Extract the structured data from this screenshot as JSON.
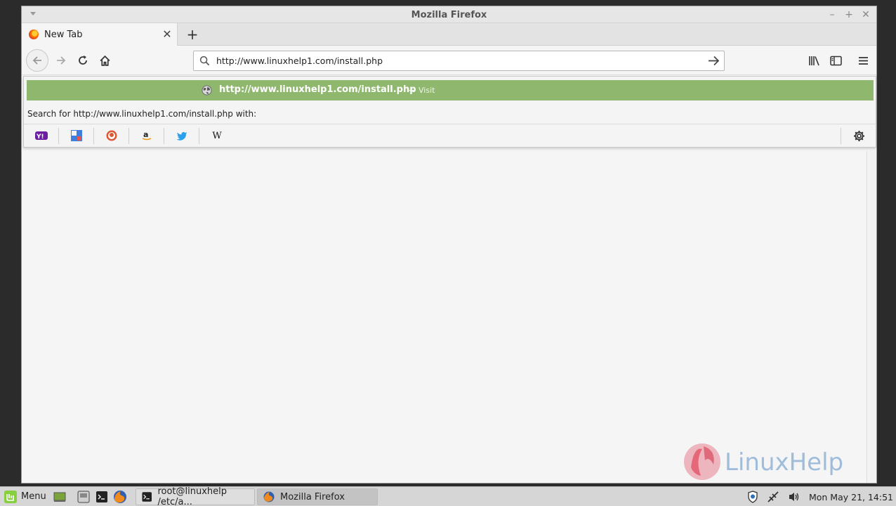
{
  "window": {
    "title": "Mozilla Firefox"
  },
  "tab": {
    "title": "New Tab"
  },
  "urlbar": {
    "value": "http://www.linuxhelp1.com/install.php"
  },
  "popup": {
    "suggestion_url": "http://www.linuxhelp1.com/install.php",
    "suggestion_sep": "—",
    "suggestion_action": "Visit",
    "search_with": "Search for http://www.linuxhelp1.com/install.php with:",
    "engines": [
      "Yahoo",
      "Google",
      "DuckDuckGo",
      "Amazon",
      "Twitter",
      "Wikipedia"
    ],
    "wikipedia_glyph": "W"
  },
  "watermark": {
    "text": "LinuxHelp"
  },
  "taskbar": {
    "menu_label": "Menu",
    "tasks": [
      {
        "label": "root@linuxhelp /etc/a..."
      },
      {
        "label": "Mozilla Firefox"
      }
    ],
    "clock": "Mon May 21, 14:51"
  },
  "colors": {
    "suggest_bg": "#8fb86e",
    "watermark_red": "#e35a6d",
    "watermark_blue": "#5b8fc7"
  }
}
